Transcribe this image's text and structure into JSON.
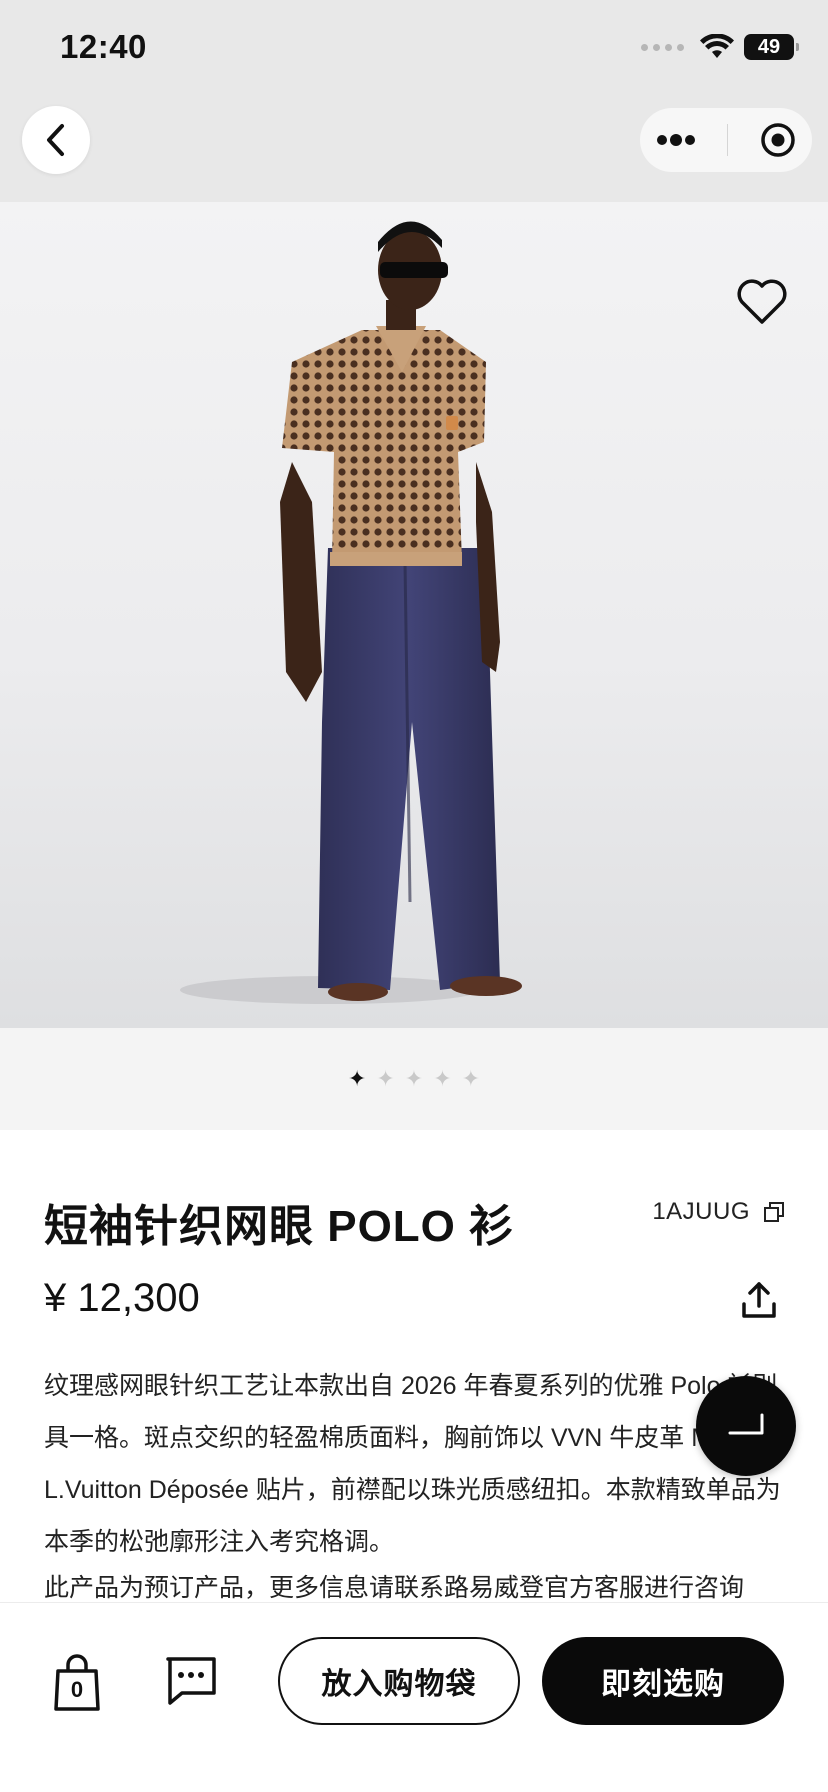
{
  "status_bar": {
    "time": "12:40",
    "battery_level": "49",
    "icons": [
      "signal-dots-icon",
      "wifi-icon",
      "battery-icon"
    ]
  },
  "nav": {
    "back_icon": "chevron-left-icon",
    "capsule_icons": [
      "more-dots-icon",
      "close-target-icon"
    ]
  },
  "gallery": {
    "image_alt": "Model wearing short-sleeve knit mesh polo shirt with navy wide trousers",
    "total_images": 5,
    "active_index": 0,
    "favorite_icon": "heart-outline-icon"
  },
  "product": {
    "title": "短袖针织网眼 POLO 衫",
    "sku": "1AJUUG",
    "price": "¥ 12,300",
    "description": "纹理感网眼针织工艺让本款出自 2026 年春夏系列的优雅 Polo 衫别具一格。斑点交织的轻盈棉质面料，胸前饰以 VVN 牛皮革 M L.Vuitton Déposée 贴片，前襟配以珠光质感纽扣。本款精致单品为本季的松弛廓形注入考究格调。",
    "notice": "此产品为预订产品，更多信息请联系路易威登官方客服进行咨询"
  },
  "bottom_bar": {
    "bag_count": "0",
    "add_to_bag_label": "放入购物袋",
    "buy_now_label": "即刻选购"
  },
  "colors": {
    "accent": "#0a0a0a",
    "background": "#ffffff",
    "header_bg": "#e8e8e8"
  }
}
